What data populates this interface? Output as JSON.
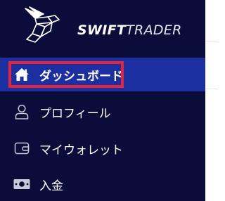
{
  "brand": {
    "name_bold": "SWIFT",
    "name_light": "TRADER",
    "logo_icon": "rabbit-logo-icon"
  },
  "nav": [
    {
      "label": "ダッシュボード",
      "icon": "home-icon",
      "active": true
    },
    {
      "label": "プロフィール",
      "icon": "user-icon",
      "active": false
    },
    {
      "label": "マイウォレット",
      "icon": "wallet-icon",
      "active": false
    },
    {
      "label": "入金",
      "icon": "cash-icon",
      "active": false
    }
  ],
  "colors": {
    "sidebar_bg": "#0c0c3a",
    "active_bg": "#1b2fa0",
    "highlight_border": "#e5243a",
    "text": "#ffffff"
  }
}
